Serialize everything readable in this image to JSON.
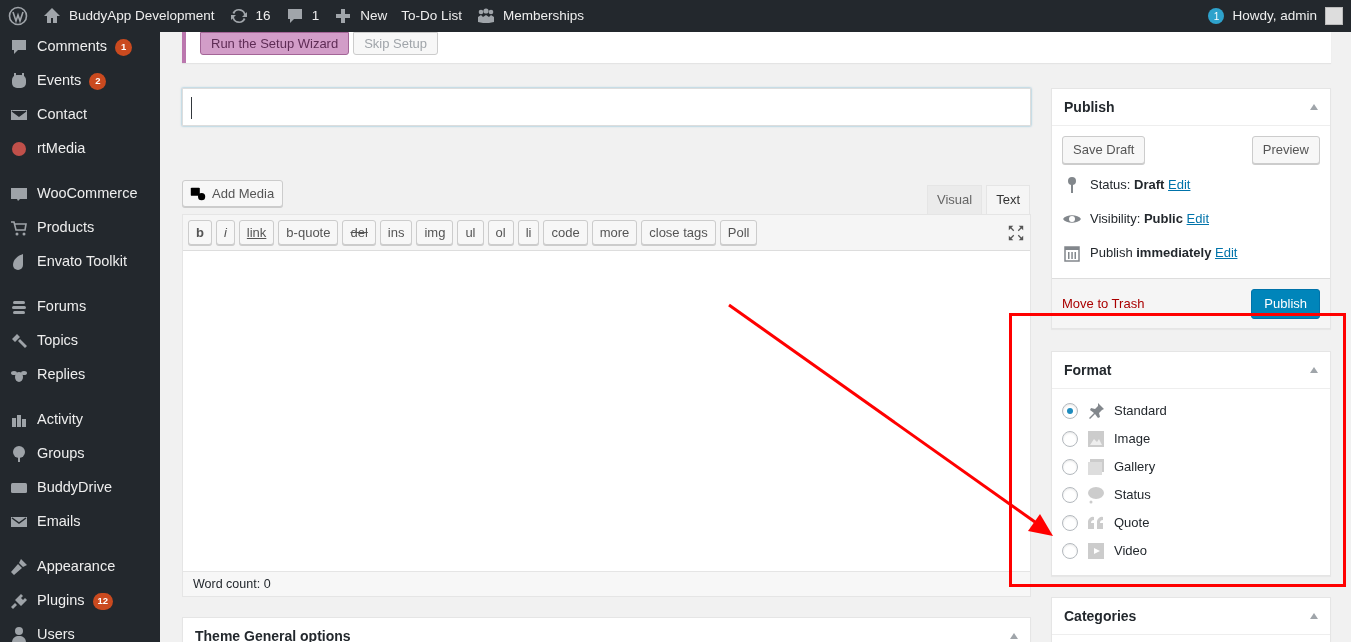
{
  "admin_bar": {
    "site": "BuddyApp Development",
    "updates": "16",
    "comments": "1",
    "new": "New",
    "links": [
      "To-Do List",
      "Memberships"
    ],
    "notifications": "1",
    "greeting": "Howdy, admin"
  },
  "sidebar": {
    "sections": [
      {
        "items": [
          {
            "label": "Comments",
            "badge": "1"
          },
          {
            "label": "Events",
            "badge": "2"
          },
          {
            "label": "Contact"
          },
          {
            "label": "rtMedia"
          }
        ]
      },
      {
        "items": [
          {
            "label": "WooCommerce"
          },
          {
            "label": "Products"
          },
          {
            "label": "Envato Toolkit"
          }
        ]
      },
      {
        "items": [
          {
            "label": "Forums"
          },
          {
            "label": "Topics"
          },
          {
            "label": "Replies"
          }
        ]
      },
      {
        "items": [
          {
            "label": "Activity"
          },
          {
            "label": "Groups"
          },
          {
            "label": "BuddyDrive"
          },
          {
            "label": "Emails"
          }
        ]
      },
      {
        "items": [
          {
            "label": "Appearance"
          },
          {
            "label": "Plugins",
            "badge": "12"
          },
          {
            "label": "Users"
          }
        ]
      }
    ]
  },
  "notice": {
    "buttons": [
      {
        "label": "Run the Setup Wizard",
        "kind": "primary"
      },
      {
        "label": "Skip Setup",
        "kind": "secondary"
      }
    ]
  },
  "editor": {
    "add_media": "Add Media",
    "tabs": [
      {
        "label": "Visual",
        "selected": false
      },
      {
        "label": "Text",
        "selected": true
      }
    ],
    "quicktags": [
      {
        "label": "b",
        "kind": "bold"
      },
      {
        "label": "i",
        "kind": "italic"
      },
      {
        "label": "link",
        "kind": "underline"
      },
      {
        "label": "b-quote",
        "kind": "plain"
      },
      {
        "label": "del",
        "kind": "strike"
      },
      {
        "label": "ins",
        "kind": "plain"
      },
      {
        "label": "img",
        "kind": "plain"
      },
      {
        "label": "ul",
        "kind": "plain"
      },
      {
        "label": "ol",
        "kind": "plain"
      },
      {
        "label": "li",
        "kind": "plain"
      },
      {
        "label": "code",
        "kind": "plain"
      },
      {
        "label": "more",
        "kind": "plain"
      },
      {
        "label": "close tags",
        "kind": "plain"
      },
      {
        "label": "Poll",
        "kind": "plain"
      }
    ],
    "word_count": "Word count: 0"
  },
  "main_boxes": [
    {
      "title": "Theme General options"
    }
  ],
  "publish": {
    "title": "Publish",
    "save_draft": "Save Draft",
    "preview": "Preview",
    "rows": [
      {
        "label": "Status:",
        "value": "Draft",
        "link": "Edit"
      },
      {
        "label": "Visibility:",
        "value": "Public",
        "link": "Edit"
      },
      {
        "label": "Publish",
        "value": "immediately",
        "link": "Edit"
      }
    ],
    "trash": "Move to Trash",
    "publish_button": "Publish"
  },
  "format": {
    "title": "Format",
    "options": [
      {
        "label": "Standard",
        "selected": true
      },
      {
        "label": "Image",
        "selected": false
      },
      {
        "label": "Gallery",
        "selected": false
      },
      {
        "label": "Status",
        "selected": false
      },
      {
        "label": "Quote",
        "selected": false
      },
      {
        "label": "Video",
        "selected": false
      }
    ]
  },
  "categories": {
    "title": "Categories"
  }
}
